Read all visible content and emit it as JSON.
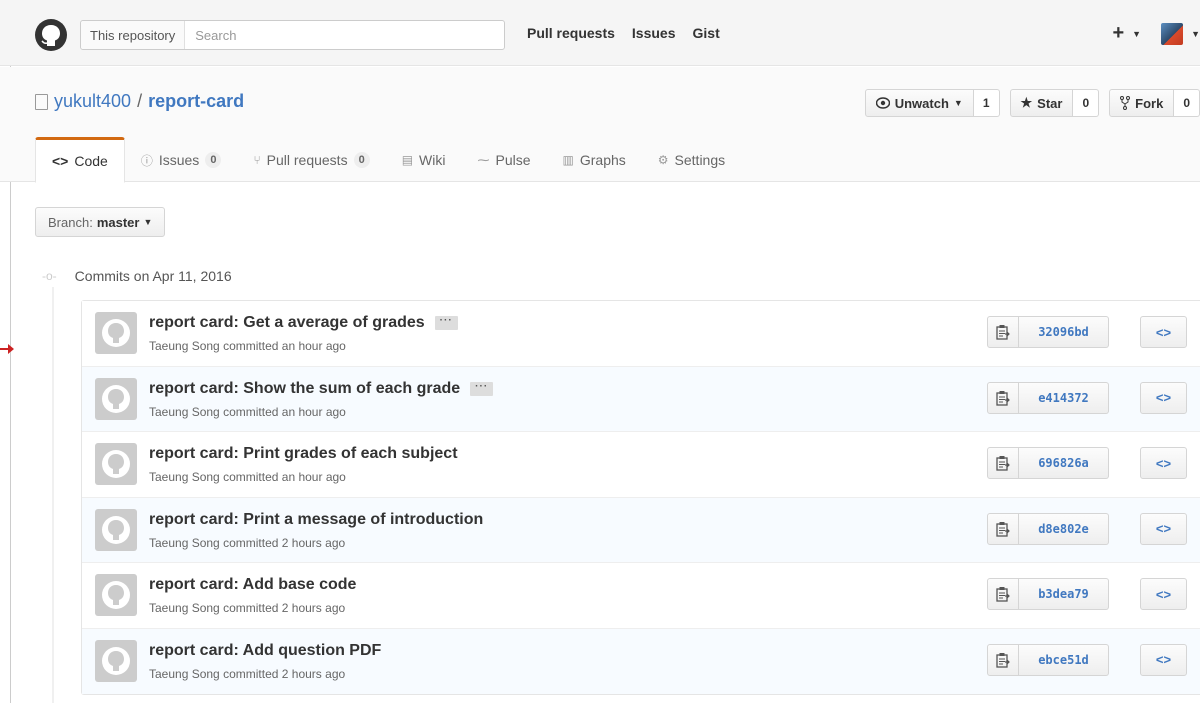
{
  "header": {
    "search_scope": "This repository",
    "search_placeholder": "Search",
    "nav": [
      "Pull requests",
      "Issues",
      "Gist"
    ],
    "plus": "+"
  },
  "repo": {
    "owner": "yukult400",
    "separator": "/",
    "name": "report-card",
    "unwatch_label": "Unwatch",
    "unwatch_count": "1",
    "star_label": "Star",
    "star_count": "0",
    "fork_label": "Fork",
    "fork_count": "0"
  },
  "tabs": [
    {
      "label": "Code",
      "badge": "",
      "icon": "code-icon"
    },
    {
      "label": "Issues",
      "badge": "0",
      "icon": "issue-icon"
    },
    {
      "label": "Pull requests",
      "badge": "0",
      "icon": "pull-request-icon"
    },
    {
      "label": "Wiki",
      "badge": "",
      "icon": "book-icon"
    },
    {
      "label": "Pulse",
      "badge": "",
      "icon": "pulse-icon"
    },
    {
      "label": "Graphs",
      "badge": "",
      "icon": "graph-icon"
    },
    {
      "label": "Settings",
      "badge": "",
      "icon": "gear-icon"
    }
  ],
  "branch": {
    "prefix": "Branch:",
    "name": "master"
  },
  "commits_group": "Commits on Apr 11, 2016",
  "commits": [
    {
      "title": "report card: Get a average of grades",
      "has_more": true,
      "author": "Taeung Song",
      "verb": "committed",
      "time": "an hour ago",
      "sha": "32096bd"
    },
    {
      "title": "report card: Show the sum of each grade",
      "has_more": true,
      "author": "Taeung Song",
      "verb": "committed",
      "time": "an hour ago",
      "sha": "e414372"
    },
    {
      "title": "report card: Print grades of each subject",
      "has_more": false,
      "author": "Taeung Song",
      "verb": "committed",
      "time": "an hour ago",
      "sha": "696826a"
    },
    {
      "title": "report card: Print a message of introduction",
      "has_more": false,
      "author": "Taeung Song",
      "verb": "committed",
      "time": "2 hours ago",
      "sha": "d8e802e"
    },
    {
      "title": "report card: Add base code",
      "has_more": false,
      "author": "Taeung Song",
      "verb": "committed",
      "time": "2 hours ago",
      "sha": "b3dea79"
    },
    {
      "title": "report card: Add question PDF",
      "has_more": false,
      "author": "Taeung Song",
      "verb": "committed",
      "time": "2 hours ago",
      "sha": "ebce51d"
    }
  ],
  "colors": {
    "accent": "#4078c0",
    "tab_highlight": "#d26911",
    "annotation_arrow": "#cc2222"
  }
}
